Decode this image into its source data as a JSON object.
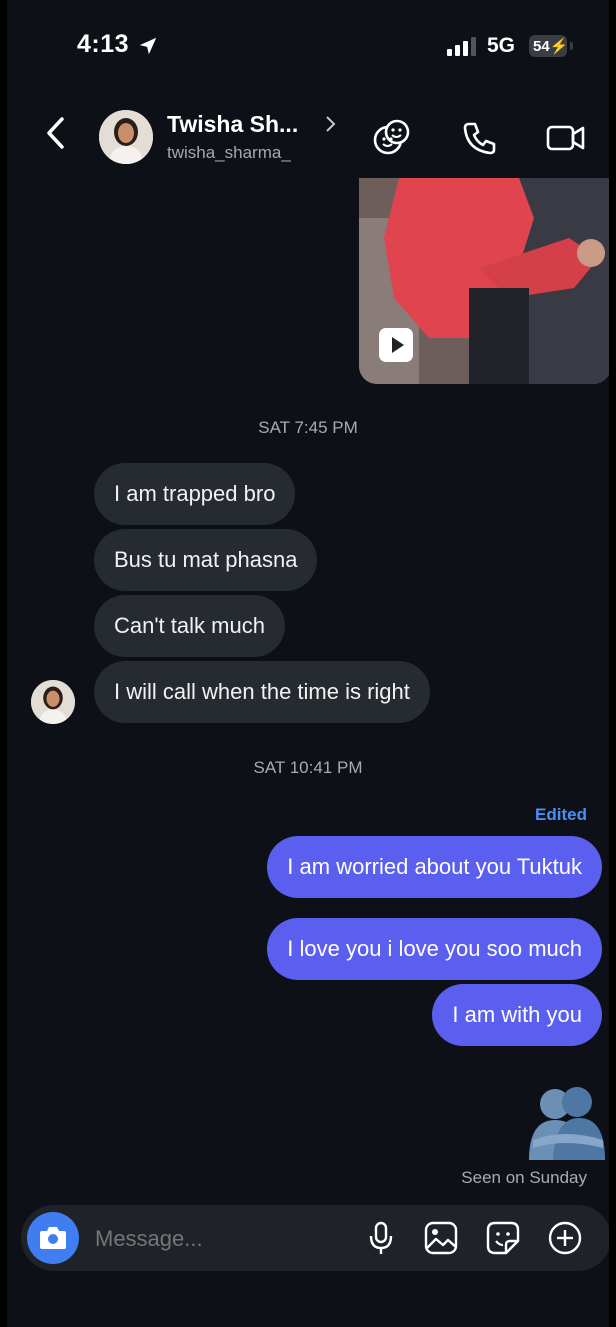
{
  "status_bar": {
    "time": "4:13",
    "network": "5G",
    "battery": "54"
  },
  "header": {
    "name": "Twisha Sh...",
    "username": "twisha_sharma_"
  },
  "thread": {
    "timestamp_1": "SAT 7:45 PM",
    "incoming": [
      "I am trapped bro",
      "Bus tu mat phasna",
      "Can't talk much",
      "I will call when the time is right"
    ],
    "timestamp_2": "SAT 10:41 PM",
    "edited_label": "Edited",
    "outgoing": [
      "I am worried about you Tuktuk",
      "I love you i love you soo much",
      "I am with you"
    ],
    "seen": "Seen on Sunday"
  },
  "composer": {
    "placeholder": "Message..."
  },
  "colors": {
    "outgoing_bubble": "#5b5ff0",
    "incoming_bubble": "#262a31",
    "accent": "#3f7df0",
    "background": "#0d1117"
  },
  "icons": [
    "location-arrow-icon",
    "signal-icon",
    "battery-icon",
    "back-icon",
    "chevron-right-icon",
    "themes-icon",
    "phone-icon",
    "video-icon",
    "play-icon",
    "camera-icon",
    "mic-icon",
    "gallery-icon",
    "sticker-icon",
    "plus-icon"
  ]
}
